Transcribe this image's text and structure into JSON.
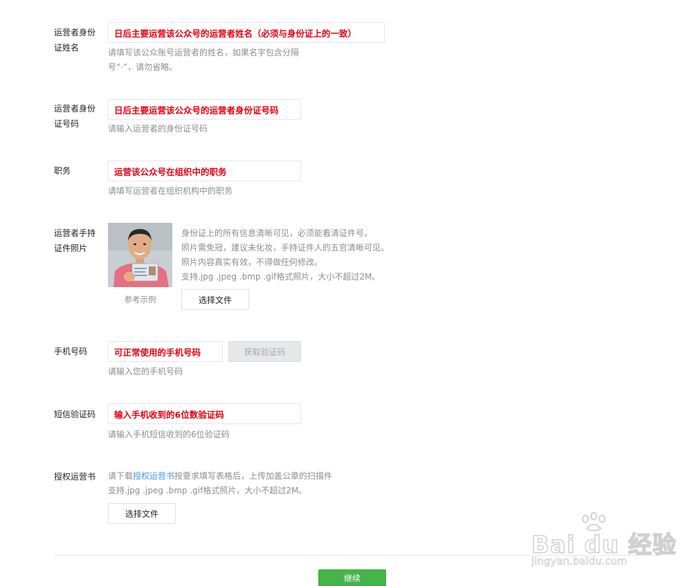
{
  "form": {
    "id_name": {
      "label": "运营者身份证姓名",
      "annotation": "日后主要运营该公众号的运营者姓名（必须与身份证上的一致）",
      "help": [
        "请填写该公众账号运营者的姓名，如果名字包含分隔",
        "号“·”，请勿省略。"
      ]
    },
    "id_number": {
      "label": "运营者身份证号码",
      "annotation": "日后主要运营该公众号的运营者身份证号码",
      "help": "请输入运营者的身份证号码"
    },
    "position": {
      "label": "职务",
      "annotation": "运营该公众号在组织中的职务",
      "help": "请填写运营者在组织机构中的职务"
    },
    "id_photo": {
      "label": "运营者手持证件照片",
      "example_caption": "参考示例",
      "rules": [
        "身份证上的所有信息清晰可见，必须能看清证件号。",
        "照片需免冠，建议未化妆，手持证件人的五官清晰可见。",
        "照片内容真实有效，不得做任何修改。",
        "支持.jpg .jpeg .bmp .gif格式照片，大小不超过2M。"
      ],
      "choose_button": "选择文件"
    },
    "phone": {
      "label": "手机号码",
      "annotation": "可正常使用的手机号码",
      "get_code_button": "获取验证码",
      "help": "请输入您的手机号码"
    },
    "sms_code": {
      "label": "短信验证码",
      "annotation": "输入手机收到的6位数验证码",
      "help": "请输入手机短信收到的6位验证码"
    },
    "authorization": {
      "label": "授权运营书",
      "help_before": "请下载",
      "help_link": "授权运营书",
      "help_after": "按要求填写表格后，上传加盖公章的扫描件",
      "help_line2": "支持.jpg .jpeg .bmp .gif格式照片，大小不超过2M。",
      "choose_button": "选择文件"
    },
    "continue_button": "继续"
  },
  "watermark": {
    "brand": "Bai du 经验",
    "url": "jingyan.baidu.com"
  },
  "colors": {
    "annotation_red": "#e60012",
    "primary_green": "#44b549",
    "link_blue": "#459ae9"
  }
}
